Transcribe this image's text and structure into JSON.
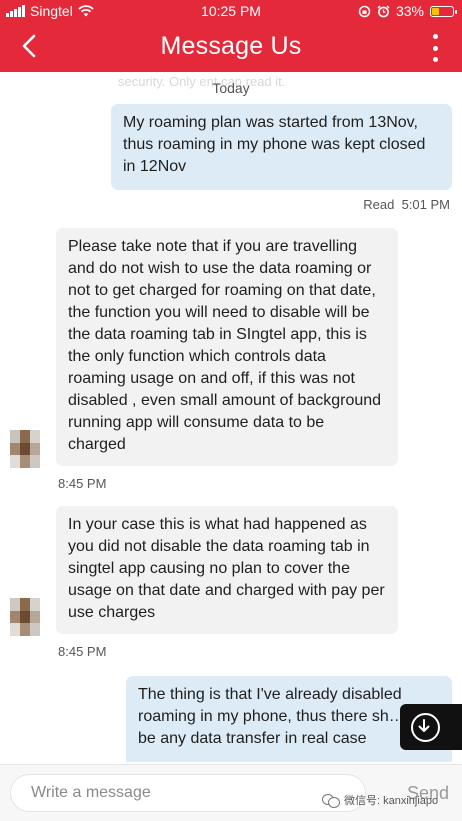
{
  "status_bar": {
    "carrier": "Singtel",
    "time": "10:25 PM",
    "battery": "33%",
    "battery_level": 0.33,
    "icons": [
      "signal-icon",
      "wifi-icon",
      "screen-rotation-lock-icon",
      "alarm-icon",
      "battery-icon"
    ]
  },
  "header": {
    "title": "Message Us",
    "back_icon": "chevron-left-icon",
    "menu_icon": "more-vertical-icon"
  },
  "chat": {
    "ghost_text": "security. Only                ent can read it.",
    "date_label": "Today",
    "messages": [
      {
        "from": "user",
        "text": "My roaming plan was started from 13Nov, thus roaming in my phone was kept closed in 12Nov",
        "status": "Read",
        "time": "5:01 PM"
      },
      {
        "from": "agent",
        "text": "Please take note that if you are travelling and do not wish to use the data roaming or not to get charged for roaming on that date, the function you will need to disable will be the data roaming tab in SIngtel app, this is the only function which controls data roaming usage on and off, if this was not disabled , even small amount of background running app will consume data to be charged",
        "time": "8:45 PM"
      },
      {
        "from": "agent",
        "text": "In your case this is what had happened as you did not disable the data roaming tab in singtel app causing no plan to cover the usage on that date and charged with pay per use charges",
        "time": "8:45 PM"
      },
      {
        "from": "user",
        "text": "The thing is that I've already disabled roaming in my phone, thus there sh… not be any data transfer in real case"
      }
    ]
  },
  "composer": {
    "placeholder": "Write a message",
    "send_label": "Send"
  },
  "watermark": {
    "text": "微信号: kanxinjiapo"
  },
  "colors": {
    "brand_red": "#e42a3a",
    "outgoing_bubble": "#dcebf6",
    "incoming_bubble": "#f2f2f2"
  }
}
